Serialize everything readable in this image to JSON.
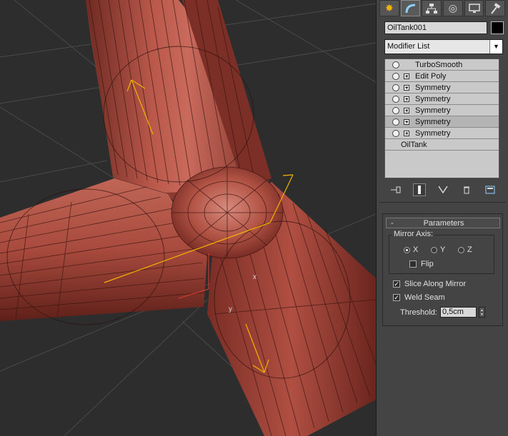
{
  "command_panel": {
    "tabs": [
      {
        "name": "create",
        "icon": "sun-star-icon"
      },
      {
        "name": "modify",
        "icon": "bent-tube-icon"
      },
      {
        "name": "hierarchy",
        "icon": "hierarchy-icon"
      },
      {
        "name": "motion",
        "icon": "circle-target-icon"
      },
      {
        "name": "display",
        "icon": "monitor-icon"
      },
      {
        "name": "utilities",
        "icon": "hammer-icon"
      }
    ],
    "active_tab": "modify",
    "object_name": "OilTank001",
    "object_color": "#000000",
    "modifier_list_label": "Modifier List",
    "modifier_stack": [
      {
        "label": "TurboSmooth",
        "has_bulb": true,
        "expandable": false
      },
      {
        "label": "Edit Poly",
        "has_bulb": true,
        "expandable": true
      },
      {
        "label": "Symmetry",
        "has_bulb": true,
        "expandable": true
      },
      {
        "label": "Symmetry",
        "has_bulb": true,
        "expandable": true
      },
      {
        "label": "Symmetry",
        "has_bulb": true,
        "expandable": true
      },
      {
        "label": "Symmetry",
        "has_bulb": true,
        "expandable": true,
        "selected": true
      },
      {
        "label": "Symmetry",
        "has_bulb": true,
        "expandable": true
      },
      {
        "label": "OilTank",
        "has_bulb": false,
        "expandable": false
      }
    ],
    "stack_tools": [
      "pin-stack-icon",
      "show-end-result-icon",
      "make-unique-icon",
      "remove-modifier-icon",
      "configure-modifier-sets-icon"
    ]
  },
  "parameters": {
    "rollout_toggle": "-",
    "title": "Parameters",
    "mirror_axis_label": "Mirror Axis:",
    "axes": [
      {
        "label": "X",
        "selected": true
      },
      {
        "label": "Y",
        "selected": false
      },
      {
        "label": "Z",
        "selected": false
      }
    ],
    "flip": {
      "label": "Flip",
      "checked": false
    },
    "slice_along_mirror": {
      "label": "Slice Along Mirror",
      "checked": true
    },
    "weld_seam": {
      "label": "Weld Seam",
      "checked": true
    },
    "threshold_label": "Threshold:",
    "threshold_value": "0,5cm"
  },
  "viewport": {
    "axis_labels": {
      "x": "x",
      "y": "y"
    },
    "mesh_color": "#a84a3d",
    "gizmo_color": "#f0b400"
  }
}
